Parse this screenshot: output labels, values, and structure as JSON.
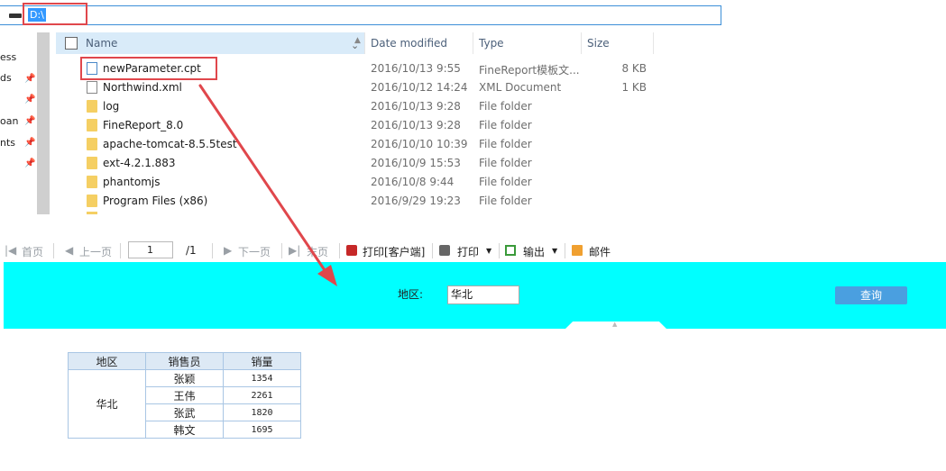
{
  "address": {
    "path": "D:\\"
  },
  "nav_pane": {
    "items": [
      "ess",
      "ds",
      "oan",
      "nts"
    ]
  },
  "columns": {
    "name": "Name",
    "date": "Date modified",
    "type": "Type",
    "size": "Size"
  },
  "files": [
    {
      "name": "newParameter.cpt",
      "date": "2016/10/13 9:55",
      "type": "FineReport模板文...",
      "size": "8 KB",
      "icon": "cpt-file-icon"
    },
    {
      "name": "Northwind.xml",
      "date": "2016/10/12 14:24",
      "type": "XML Document",
      "size": "1 KB",
      "icon": "file-icon"
    },
    {
      "name": "log",
      "date": "2016/10/13 9:28",
      "type": "File folder",
      "size": "",
      "icon": "folder-icon"
    },
    {
      "name": "FineReport_8.0",
      "date": "2016/10/13 9:28",
      "type": "File folder",
      "size": "",
      "icon": "folder-icon"
    },
    {
      "name": "apache-tomcat-8.5.5test",
      "date": "2016/10/10 10:39",
      "type": "File folder",
      "size": "",
      "icon": "folder-icon"
    },
    {
      "name": "ext-4.2.1.883",
      "date": "2016/10/9 15:53",
      "type": "File folder",
      "size": "",
      "icon": "folder-icon"
    },
    {
      "name": "phantomjs",
      "date": "2016/10/8 9:44",
      "type": "File folder",
      "size": "",
      "icon": "folder-icon"
    },
    {
      "name": "Program Files (x86)",
      "date": "2016/9/29 19:23",
      "type": "File folder",
      "size": "",
      "icon": "folder-icon"
    }
  ],
  "toolbar": {
    "first": "首页",
    "prev": "上一页",
    "page_value": "1",
    "page_total": "/1",
    "next": "下一页",
    "last": "末页",
    "print_client": "打印[客户端]",
    "print": "打印",
    "export": "输出",
    "email": "邮件"
  },
  "param": {
    "region_label": "地区:",
    "region_value": "华北",
    "query_label": "查询"
  },
  "report": {
    "headers": [
      "地区",
      "销售员",
      "销量"
    ],
    "region": "华北",
    "rows": [
      {
        "salesperson": "张颖",
        "sales": "1354"
      },
      {
        "salesperson": "王伟",
        "sales": "2261"
      },
      {
        "salesperson": "张武",
        "sales": "1820"
      },
      {
        "salesperson": "韩文",
        "sales": "1695"
      }
    ]
  },
  "colors": {
    "highlight": "#e0474c",
    "param_background": "#00ffff",
    "query_button": "#4a9fe0",
    "table_border": "#a9c6e4"
  }
}
